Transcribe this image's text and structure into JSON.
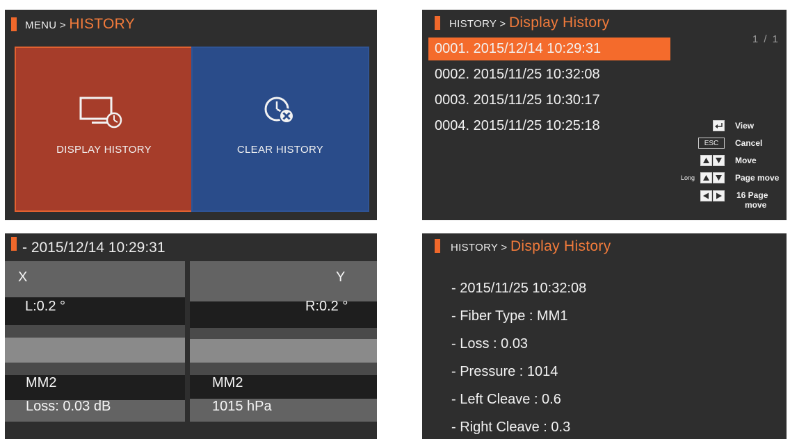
{
  "colors": {
    "accent": "#f0682b",
    "panel_bg": "#2e2e2e",
    "tile_red": "#a63d2a",
    "tile_blue": "#2a4c8a",
    "selection": "#f46b2c"
  },
  "panel1": {
    "breadcrumb_prefix": "MENU >",
    "breadcrumb_current": "HISTORY",
    "tiles": [
      {
        "label": "DISPLAY HISTORY",
        "icon": "monitor-clock-icon"
      },
      {
        "label": "CLEAR HISTORY",
        "icon": "clock-clear-icon"
      }
    ]
  },
  "panel2": {
    "breadcrumb_prefix": "HISTORY >",
    "breadcrumb_current": "Display History",
    "page_indicator": "1 /    1",
    "rows": [
      {
        "text": "0001. 2015/12/14  10:29:31",
        "selected": true
      },
      {
        "text": "0002. 2015/11/25  10:32:08",
        "selected": false
      },
      {
        "text": "0003. 2015/11/25  10:30:17",
        "selected": false
      },
      {
        "text": "0004. 2015/11/25  10:25:18",
        "selected": false
      }
    ],
    "legend": {
      "view": "View",
      "esc_key": "ESC",
      "cancel": "Cancel",
      "move": "Move",
      "long_prefix": "Long",
      "page_move": "Page move",
      "page16_line1": "16 Page",
      "page16_line2": "move"
    }
  },
  "panel3": {
    "title": "- 2015/12/14 10:29:31",
    "x_label": "X",
    "y_label": "Y",
    "left_angle": "L:0.2 °",
    "right_angle": "R:0.2 °",
    "left_fiber": "MM2",
    "right_fiber": "MM2",
    "loss": "Loss: 0.03 dB",
    "pressure": "1015 hPa"
  },
  "panel4": {
    "breadcrumb_prefix": "HISTORY >",
    "breadcrumb_current": "Display History",
    "lines": [
      "- 2015/11/25 10:32:08",
      "- Fiber Type : MM1",
      "- Loss : 0.03",
      "- Pressure : 1014",
      "- Left Cleave : 0.6",
      "- Right Cleave : 0.3"
    ]
  }
}
